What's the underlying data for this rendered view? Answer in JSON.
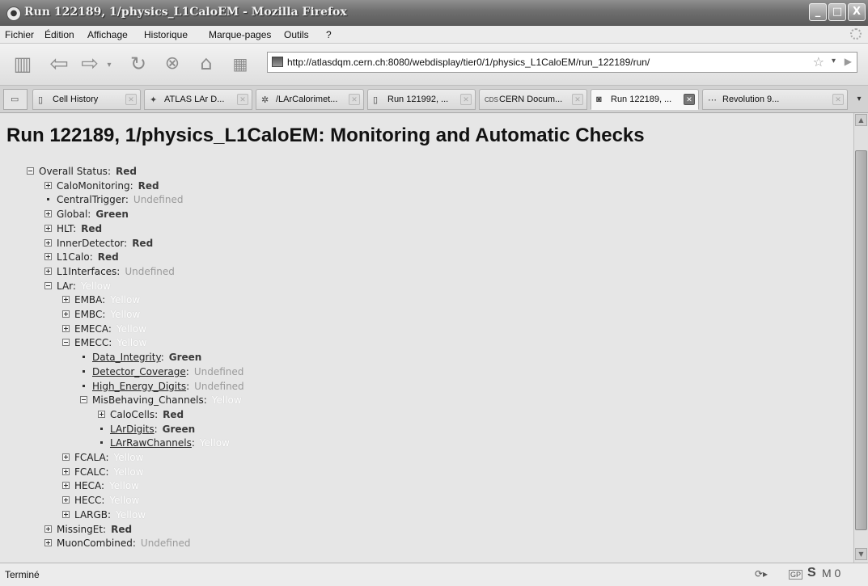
{
  "window": {
    "title": "Run 122189, 1/physics_L1CaloEM - Mozilla Firefox",
    "minimize": "_",
    "maximize": "□",
    "close": "X"
  },
  "menu": [
    "Fichier",
    "Édition",
    "Affichage",
    "Historique",
    "Marque-pages",
    "Outils",
    "?"
  ],
  "toolbar": {
    "url": "http://atlasdqm.cern.ch:8080/webdisplay/tier0/1/physics_L1CaloEM/run_122189/run/"
  },
  "tabs": [
    {
      "label": "",
      "icon": "page-icon"
    },
    {
      "label": "Cell History",
      "icon": "page-icon"
    },
    {
      "label": "ATLAS LAr D...",
      "icon": "atlas-icon"
    },
    {
      "label": "/LArCalorimet...",
      "icon": "star-icon"
    },
    {
      "label": "Run 121992, ...",
      "icon": "page-icon"
    },
    {
      "label": "CERN Docum...",
      "icon": "cds-icon"
    },
    {
      "label": "Run 122189, ...",
      "icon": "monitor-icon",
      "active": true
    },
    {
      "label": "Revolution 9...",
      "icon": "dots-icon"
    }
  ],
  "page": {
    "title": "Run 122189, 1/physics_L1CaloEM: Monitoring and Automatic Checks"
  },
  "tree": [
    {
      "name": "Overall Status:",
      "status": "Red",
      "level": 0,
      "toggle": "minus"
    },
    {
      "name": "CaloMonitoring:",
      "status": "Red",
      "level": 1,
      "toggle": "plus"
    },
    {
      "name": "CentralTrigger:",
      "status": "Undefined",
      "level": 1,
      "toggle": "bullet"
    },
    {
      "name": "Global:",
      "status": "Green",
      "level": 1,
      "toggle": "plus"
    },
    {
      "name": "HLT:",
      "status": "Red",
      "level": 1,
      "toggle": "plus"
    },
    {
      "name": "InnerDetector:",
      "status": "Red",
      "level": 1,
      "toggle": "plus"
    },
    {
      "name": "L1Calo:",
      "status": "Red",
      "level": 1,
      "toggle": "plus"
    },
    {
      "name": "L1Interfaces:",
      "status": "Undefined",
      "level": 1,
      "toggle": "plus"
    },
    {
      "name": "LAr:",
      "status": "Yellow",
      "level": 1,
      "toggle": "minus"
    },
    {
      "name": "EMBA:",
      "status": "Yellow",
      "level": 2,
      "toggle": "plus"
    },
    {
      "name": "EMBC:",
      "status": "Yellow",
      "level": 2,
      "toggle": "plus"
    },
    {
      "name": "EMECA:",
      "status": "Yellow",
      "level": 2,
      "toggle": "plus"
    },
    {
      "name": "EMECC:",
      "status": "Yellow",
      "level": 2,
      "toggle": "minus"
    },
    {
      "name": "Data_Integrity",
      "status": "Green",
      "level": 3,
      "toggle": "bullet",
      "link": true
    },
    {
      "name": "Detector_Coverage",
      "status": "Undefined",
      "level": 3,
      "toggle": "bullet",
      "link": true
    },
    {
      "name": "High_Energy_Digits",
      "status": "Undefined",
      "level": 3,
      "toggle": "bullet",
      "link": true
    },
    {
      "name": "MisBehaving_Channels:",
      "status": "Yellow",
      "level": 3,
      "toggle": "minus"
    },
    {
      "name": "CaloCells:",
      "status": "Red",
      "level": 4,
      "toggle": "plus"
    },
    {
      "name": "LArDigits",
      "status": "Green",
      "level": 4,
      "toggle": "bullet",
      "link": true
    },
    {
      "name": "LArRawChannels",
      "status": "Yellow",
      "level": 4,
      "toggle": "bullet",
      "link": true
    },
    {
      "name": "FCALA:",
      "status": "Yellow",
      "level": 2,
      "toggle": "plus"
    },
    {
      "name": "FCALC:",
      "status": "Yellow",
      "level": 2,
      "toggle": "plus"
    },
    {
      "name": "HECA:",
      "status": "Yellow",
      "level": 2,
      "toggle": "plus"
    },
    {
      "name": "HECC:",
      "status": "Yellow",
      "level": 2,
      "toggle": "plus"
    },
    {
      "name": "LARGB:",
      "status": "Yellow",
      "level": 2,
      "toggle": "plus"
    },
    {
      "name": "MissingEt:",
      "status": "Red",
      "level": 1,
      "toggle": "plus"
    },
    {
      "name": "MuonCombined:",
      "status": "Undefined",
      "level": 1,
      "toggle": "plus"
    }
  ],
  "statusbar": {
    "text": "Terminé",
    "addon_gp": "GP",
    "addon_s": "S",
    "addon_m": "M 0"
  }
}
